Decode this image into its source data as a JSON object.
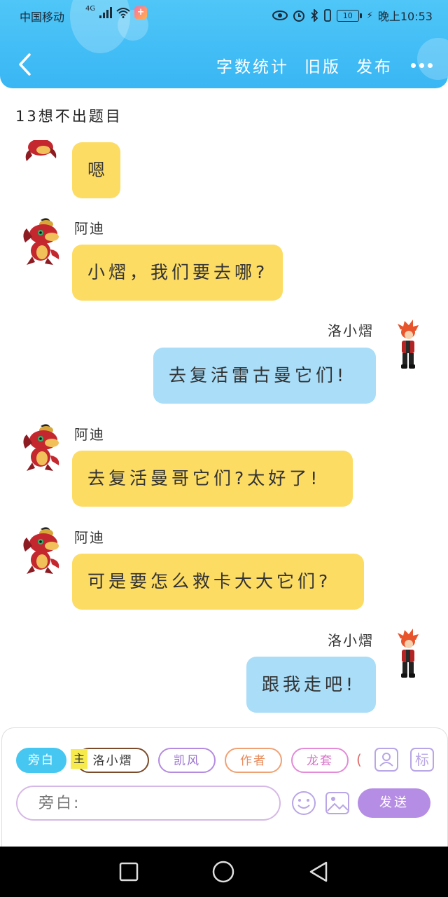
{
  "status_bar": {
    "carrier": "中国移动",
    "network": "4G",
    "battery": "10",
    "time": "晚上10:53"
  },
  "nav": {
    "word_count": "字数统计",
    "old_version": "旧版",
    "publish": "发布"
  },
  "chat": {
    "title": "13想不出题目",
    "messages": [
      {
        "speaker": "",
        "text": "嗯"
      },
      {
        "speaker": "阿迪",
        "text": "小熠，我们要去哪?"
      },
      {
        "speaker": "洛小熠",
        "text": "去复活雷古曼它们!"
      },
      {
        "speaker": "阿迪",
        "text": "去复活曼哥它们?太好了!"
      },
      {
        "speaker": "阿迪",
        "text": "可是要怎么救卡大大它们?"
      },
      {
        "speaker": "洛小熠",
        "text": "跟我走吧!"
      }
    ]
  },
  "composer": {
    "chips": [
      "旁白",
      "洛小熠",
      "凯风",
      "作者",
      "龙套",
      "("
    ],
    "main_badge": "主",
    "tag_icon": "标",
    "placeholder": "旁白:",
    "send": "发送"
  },
  "colors": {
    "header": "#39b6f4",
    "yellow_bubble": "#fddc64",
    "blue_bubble": "#a9ddf8",
    "send_button": "#b68de4"
  }
}
